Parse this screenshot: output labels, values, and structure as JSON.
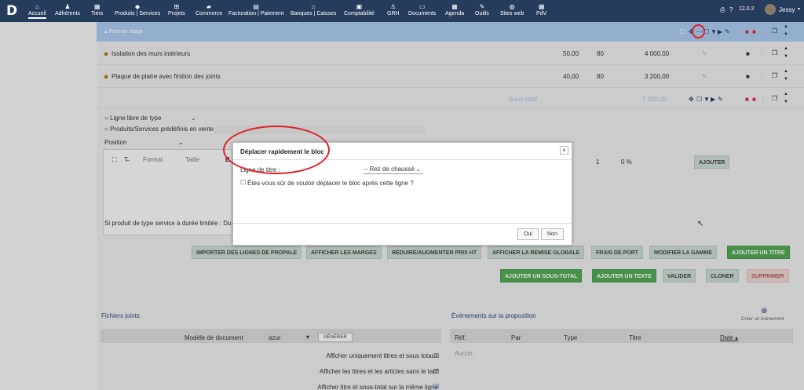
{
  "nav": {
    "logo": "D",
    "items": [
      {
        "label": "Accueil",
        "icon": "home-icon",
        "glyph": "⌂",
        "active": true
      },
      {
        "label": "Adhérents",
        "icon": "users-icon",
        "glyph": "♟"
      },
      {
        "label": "Tiers",
        "icon": "building-icon",
        "glyph": "▦"
      },
      {
        "label": "Produits | Services",
        "icon": "cube-icon",
        "glyph": "◆"
      },
      {
        "label": "Projets",
        "icon": "sitemap-icon",
        "glyph": "⊞"
      },
      {
        "label": "Commerce",
        "icon": "briefcase-icon",
        "glyph": "▰"
      },
      {
        "label": "Facturation | Paiement",
        "icon": "money-icon",
        "glyph": "▤"
      },
      {
        "label": "Banques | Caisses",
        "icon": "bank-icon",
        "glyph": "⌂"
      },
      {
        "label": "Comptabilité",
        "icon": "calculator-icon",
        "glyph": "▣"
      },
      {
        "label": "GRH",
        "icon": "user-tie-icon",
        "glyph": "♙"
      },
      {
        "label": "Documents",
        "icon": "folder-icon",
        "glyph": "▭"
      },
      {
        "label": "Agenda",
        "icon": "calendar-icon",
        "glyph": "▦"
      },
      {
        "label": "Outils",
        "icon": "wrench-icon",
        "glyph": "✎"
      },
      {
        "label": "Sites web",
        "icon": "globe-icon",
        "glyph": "◍"
      },
      {
        "label": "PdV",
        "icon": "cash-register-icon",
        "glyph": "▦"
      }
    ],
    "version": "12.0.2",
    "user": "Jessy"
  },
  "title_row": {
    "label": "Premier étage"
  },
  "lines": [
    {
      "desc": "Isolation des murs intérieurs",
      "pu": "50,00",
      "qty": "80",
      "total": "4 000,00"
    },
    {
      "desc": "Plaque de platre avec finition des joints",
      "pu": "40,00",
      "qty": "80",
      "total": "3 200,00"
    }
  ],
  "subtotal": {
    "label": "Sous-total",
    "value": "7 200,00"
  },
  "addline": {
    "free_line": "Ligne libre de type",
    "predefined": "Produits/Services prédéfinis en vente",
    "position": "Position",
    "format": "Format",
    "size": "Taille",
    "qty": "1",
    "discount": "0 %",
    "add": "AJOUTER",
    "service_note": "Si produit de type service à durée limitée : Du"
  },
  "buttons": {
    "import": "IMPORTER DES LIGNES DE PROPALE",
    "margins": "AFFICHER LES MARGES",
    "reduce": "RÉDUIRE/AUGMENTER PRIX HT",
    "discount": "AFFICHER LA REMISE GLOBALE",
    "shipping": "FRAIS DE PORT",
    "range": "MODIFIER LA GAMME",
    "add_title": "AJOUTER UN TITRE",
    "add_subtotal": "AJOUTER UN SOUS-TOTAL",
    "add_text": "AJOUTER UN TEXTE",
    "validate": "VALIDER",
    "clone": "CLONER",
    "delete": "SUPPRIMER"
  },
  "files": {
    "title": "Fichiers joints",
    "model_label": "Modèle de document",
    "model_value": "azur",
    "generate": "GÉNÉRER",
    "opt1": "Afficher uniquement titres et sous totaux",
    "opt2": "Afficher les titres et les articles sans le tarif",
    "opt3": "Afficher titre et sous-total sur la même ligne"
  },
  "events": {
    "title": "Événements sur la proposition",
    "create": "Créer un événement",
    "cols": [
      "Réf.",
      "Par",
      "Type",
      "Titre",
      "Date ▴"
    ],
    "empty": "Aucun"
  },
  "dialog": {
    "title": "Déplacer rapidement le bloc",
    "field_label": "Ligne de titre :",
    "field_value": "-- Rez de chaussé",
    "question": "Êtes-vous sûr de vouloir déplacer le bloc après cette ligne ?",
    "yes": "Oui",
    "no": "Non",
    "close": "×"
  },
  "colors": {
    "nav": "#263c5c",
    "title_row": "#a9c7ea",
    "green": "#53a656",
    "highlight": "#e0202a"
  }
}
